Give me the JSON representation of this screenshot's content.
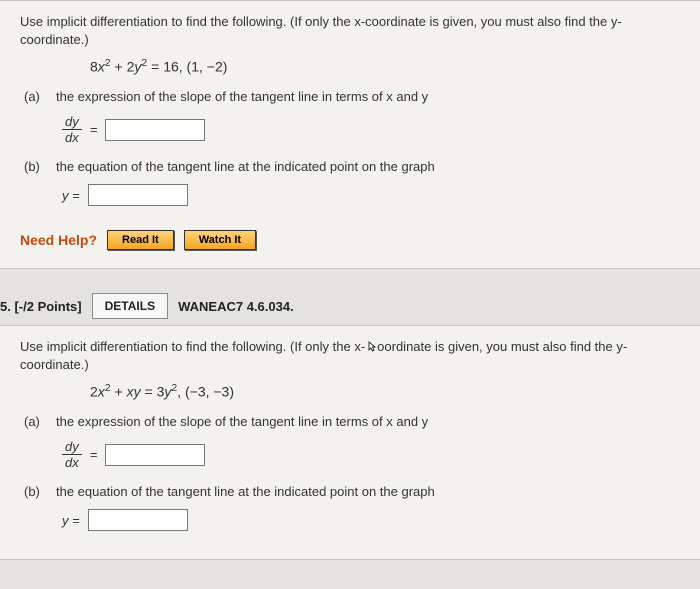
{
  "q1": {
    "intro": "Use implicit differentiation to find the following. (If only the x-coordinate is given, you must also find the y-coordinate.)",
    "equation_html": "8x² + 2y² = 16, (1, −2)",
    "partA_label": "(a)",
    "partA_text": "the expression of the slope of the tangent line in terms of x and y",
    "frac_num": "dy",
    "frac_den": "dx",
    "eq_symbol": "=",
    "partB_label": "(b)",
    "partB_text": "the equation of the tangent line at the indicated point on the graph",
    "y_eq": "y =",
    "need_help": "Need Help?",
    "read_it": "Read It",
    "watch_it": "Watch It"
  },
  "q2": {
    "number_points": "5. [-/2 Points]",
    "details": "DETAILS",
    "code": "WANEAC7 4.6.034.",
    "intro_a": "Use implicit differentiation to find the following. (If only the x-",
    "intro_b": "oordinate is given, you must also find the y-coordinate.)",
    "equation_html": "2x² + xy = 3y², (−3, −3)",
    "partA_label": "(a)",
    "partA_text": "the expression of the slope of the tangent line in terms of x and y",
    "frac_num": "dy",
    "frac_den": "dx",
    "eq_symbol": "=",
    "partB_label": "(b)",
    "partB_text": "the equation of the tangent line at the indicated point on the graph",
    "y_eq": "y ="
  }
}
